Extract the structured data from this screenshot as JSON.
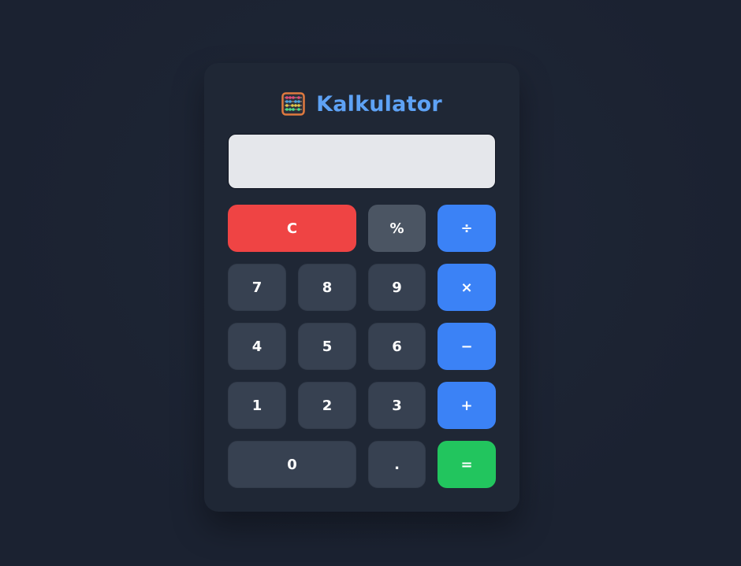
{
  "app": {
    "title": "Kalkulator",
    "logo_icon": "abacus-icon"
  },
  "display": {
    "value": ""
  },
  "keys": {
    "clear": "C",
    "percent": "%",
    "divide": "÷",
    "multiply": "×",
    "subtract": "−",
    "add": "+",
    "equals": "=",
    "decimal": ".",
    "digit_0": "0",
    "digit_1": "1",
    "digit_2": "2",
    "digit_3": "3",
    "digit_4": "4",
    "digit_5": "5",
    "digit_6": "6",
    "digit_7": "7",
    "digit_8": "8",
    "digit_9": "9"
  },
  "colors": {
    "background": "#1b2231",
    "panel": "#1f2735",
    "title": "#5ea2f5",
    "number_key": "#374151",
    "percent_key": "#4b5563",
    "operator_key": "#3b82f6",
    "clear_key": "#ef4444",
    "equals_key": "#22c55e",
    "display": "#e5e7eb"
  }
}
